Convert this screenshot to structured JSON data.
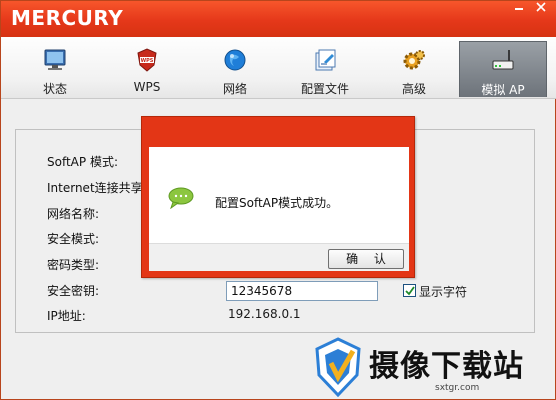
{
  "window": {
    "brand": "MERCURY"
  },
  "toolbar": {
    "items": [
      {
        "label": "状态",
        "icon": "monitor-status-icon"
      },
      {
        "label": "WPS",
        "icon": "wps-shield-icon"
      },
      {
        "label": "网络",
        "icon": "network-globe-icon"
      },
      {
        "label": "配置文件",
        "icon": "config-file-icon"
      },
      {
        "label": "高级",
        "icon": "gear-icon"
      },
      {
        "label": "模拟 AP",
        "icon": "router-icon",
        "active": true
      }
    ]
  },
  "softap": {
    "fields": [
      {
        "label": "SoftAP 模式:"
      },
      {
        "label": "Internet连接共享:"
      },
      {
        "label": "网络名称:"
      },
      {
        "label": "安全模式:"
      },
      {
        "label": "密码类型:"
      },
      {
        "label": "安全密钥:"
      },
      {
        "label": "IP地址:"
      }
    ],
    "security_key": "12345678",
    "show_chars_label": "显示字符",
    "show_chars_checked": true,
    "ip_address": "192.168.0.1"
  },
  "dialog": {
    "message": "配置SoftAP模式成功。",
    "ok_label": "确 认"
  },
  "watermark": {
    "title": "摄像下载站",
    "domain": "sxtgr.com"
  },
  "colors": {
    "accent": "#e33616",
    "active_tab": "#7a8087"
  }
}
